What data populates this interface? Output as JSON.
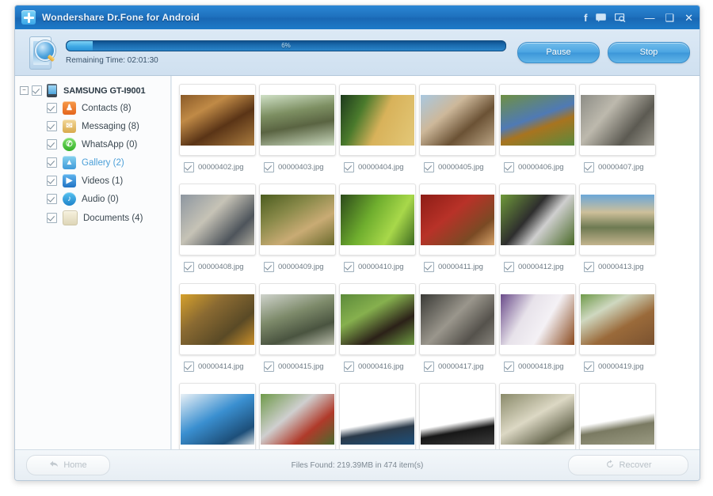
{
  "window": {
    "title": "Wondershare Dr.Fone for Android",
    "logo_icon": "wondershare-plus-icon",
    "title_icons": [
      {
        "name": "facebook-icon",
        "glyph": "f"
      },
      {
        "name": "feedback-chat-icon",
        "glyph": "⌨"
      },
      {
        "name": "screen-search-icon",
        "glyph": "⌕"
      }
    ],
    "controls": {
      "minimize": "—",
      "maximize": "❑",
      "close": "✕"
    }
  },
  "scan": {
    "icon": "phone-scan-icon",
    "progress_percent": 6,
    "progress_percent_label": "6%",
    "remaining_label": "Remaining Time: 02:01:30",
    "pause_label": "Pause",
    "stop_label": "Stop"
  },
  "sidebar": {
    "device": {
      "name": "SAMSUNG GT-I9001",
      "icon": "phone-device-icon",
      "checked": true,
      "expander": "−"
    },
    "items": [
      {
        "label": "Contacts (8)",
        "icon": "contacts-icon",
        "icon_class": "ic-contacts",
        "glyph": "♟",
        "checked": true,
        "selected": false
      },
      {
        "label": "Messaging (8)",
        "icon": "messaging-icon",
        "icon_class": "ic-messaging",
        "glyph": "✉",
        "checked": true,
        "selected": false
      },
      {
        "label": "WhatsApp (0)",
        "icon": "whatsapp-icon",
        "icon_class": "ic-whatsapp",
        "glyph": "✆",
        "checked": true,
        "selected": false
      },
      {
        "label": "Gallery (2)",
        "icon": "gallery-icon",
        "icon_class": "ic-gallery",
        "glyph": "▲",
        "checked": true,
        "selected": true
      },
      {
        "label": "Videos (1)",
        "icon": "videos-icon",
        "icon_class": "ic-videos",
        "glyph": "▶",
        "checked": true,
        "selected": false
      },
      {
        "label": "Audio (0)",
        "icon": "audio-icon",
        "icon_class": "ic-audio",
        "glyph": "♪",
        "checked": true,
        "selected": false
      },
      {
        "label": "Documents (4)",
        "icon": "documents-icon",
        "icon_class": "ic-documents",
        "glyph": "",
        "checked": true,
        "selected": false
      }
    ]
  },
  "gallery": {
    "rows": [
      {
        "cells": [
          {
            "file": "00000402.jpg",
            "checked": true,
            "thumb": "squirrel-on-bark",
            "css": "linear-gradient(150deg,#8a5a28 0%,#c08a46 30%,#5a3416 60%,#a97b3e 100%)"
          },
          {
            "file": "00000403.jpg",
            "checked": true,
            "thumb": "lynx-on-log",
            "css": "linear-gradient(170deg,#cfe0c6 0%,#7d8f62 35%,#5a6442 60%,#c9d8bd 100%)"
          },
          {
            "file": "00000404.jpg",
            "checked": true,
            "thumb": "woodpecker-on-tree",
            "css": "linear-gradient(115deg,#1d3a1c 0%,#4a7a2c 28%,#d8b25a 55%,#e3c878 100%)"
          },
          {
            "file": "00000405.jpg",
            "checked": true,
            "thumb": "wagon-wheel",
            "css": "linear-gradient(140deg,#a9c8e0 0%,#cdb89a 35%,#6b5235 65%,#b9a383 100%)"
          },
          {
            "file": "00000406.jpg",
            "checked": true,
            "thumb": "deer-in-river",
            "css": "linear-gradient(160deg,#6f9044 0%,#4f7ab5 45%,#a8741f 62%,#5b8a3d 100%)"
          },
          {
            "file": "00000407.jpg",
            "checked": true,
            "thumb": "bird-on-rock",
            "css": "linear-gradient(130deg,#8d8d86 0%,#bdb9ad 35%,#5c5a52 70%,#9a978c 100%)"
          }
        ]
      },
      {
        "cells": [
          {
            "file": "00000408.jpg",
            "checked": true,
            "thumb": "wolf",
            "css": "linear-gradient(135deg,#8d96a0 0%,#c6c3b6 40%,#4e545b 75%,#a9a79c 100%)"
          },
          {
            "file": "00000409.jpg",
            "checked": true,
            "thumb": "rabbit",
            "css": "linear-gradient(150deg,#4b5c1f 0%,#8a8a4a 35%,#c9ab74 65%,#6a6a2c 100%)"
          },
          {
            "file": "00000410.jpg",
            "checked": true,
            "thumb": "frog-on-leaf",
            "css": "linear-gradient(120deg,#2c4a1a 0%,#6fae2e 40%,#a8d84a 70%,#3e6b20 100%)"
          },
          {
            "file": "00000411.jpg",
            "checked": true,
            "thumb": "lizard-red-background",
            "css": "linear-gradient(140deg,#8d1d16 0%,#b83228 40%,#7a4a24 75%,#d6a36a 100%)"
          },
          {
            "file": "00000412.jpg",
            "checked": true,
            "thumb": "lemur",
            "css": "linear-gradient(130deg,#6f9a3a 0%,#2e2e2e 40%,#cfcfcf 60%,#4a6a28 100%)"
          },
          {
            "file": "00000413.jpg",
            "checked": true,
            "thumb": "crocodile-on-beach",
            "css": "linear-gradient(180deg,#6ba7d8 0%,#cdbf9a 35%,#6e7a52 65%,#c3b48e 100%)"
          }
        ]
      },
      {
        "cells": [
          {
            "file": "00000414.jpg",
            "checked": true,
            "thumb": "tortoise",
            "css": "linear-gradient(140deg,#d6a12c 0%,#8a6a32 35%,#5a4a26 70%,#c98f2a 100%)"
          },
          {
            "file": "00000415.jpg",
            "checked": true,
            "thumb": "garden-scene",
            "css": "linear-gradient(160deg,#cfd3cc 0%,#7d8a6a 40%,#4a5440 70%,#b7bba9 100%)"
          },
          {
            "file": "00000416.jpg",
            "checked": true,
            "thumb": "bears-in-grass",
            "css": "linear-gradient(150deg,#5c8a3a 0%,#86b04e 35%,#2b2118 68%,#6e9a42 100%)"
          },
          {
            "file": "00000417.jpg",
            "checked": true,
            "thumb": "black-white-group-photo",
            "css": "linear-gradient(135deg,#3a3a36 0%,#9a968c 45%,#55524c 75%,#85827a 100%)"
          },
          {
            "file": "00000418.jpg",
            "checked": true,
            "thumb": "open-book",
            "css": "linear-gradient(120deg,#6a4b8a 0%,#e7e2ea 35%,#f4f1f5 60%,#8a4a1e 100%)"
          },
          {
            "file": "00000419.jpg",
            "checked": true,
            "thumb": "cat-on-wooden-bench",
            "css": "linear-gradient(150deg,#6f9a4a 0%,#cfd8c0 30%,#9a6a3a 62%,#7a5230 100%)"
          }
        ]
      },
      {
        "cells": [
          {
            "file": "",
            "checked": false,
            "thumb": "blue-car",
            "css": "linear-gradient(150deg,#e8f0f6 0%,#3a8fd0 45%,#1d4f7a 80%,#cfd8de 100%)"
          },
          {
            "file": "",
            "checked": false,
            "thumb": "people-umbrella",
            "css": "linear-gradient(140deg,#6f9a4a 0%,#cfcfcf 40%,#b03a2a 70%,#4a6a2e 100%)"
          },
          {
            "file": "",
            "checked": false,
            "thumb": "stage-performance",
            "css": "linear-gradient(170deg,#ffffff 0%,#ffffff 55%,#2b3a4a 70%,#1d4f7a 100%)"
          },
          {
            "file": "",
            "checked": false,
            "thumb": "night-event",
            "css": "linear-gradient(170deg,#ffffff 0%,#ffffff 55%,#171717 70%,#3a3a3a 100%)"
          },
          {
            "file": "",
            "checked": false,
            "thumb": "vintage-portrait",
            "css": "linear-gradient(150deg,#8a8a6a 0%,#dcd8c4 45%,#6a6a52 80%,#b6b29a 100%)"
          },
          {
            "file": "",
            "checked": false,
            "thumb": "landscape-sepia",
            "css": "linear-gradient(170deg,#ffffff 0%,#ffffff 50%,#7a7a62 65%,#9a9a82 100%)"
          }
        ]
      }
    ]
  },
  "footer": {
    "home_label": "Home",
    "home_icon": "back-arrow-icon",
    "status": "Files Found: 219.39MB in 474 item(s)",
    "recover_label": "Recover",
    "recover_icon": "recover-refresh-icon"
  }
}
